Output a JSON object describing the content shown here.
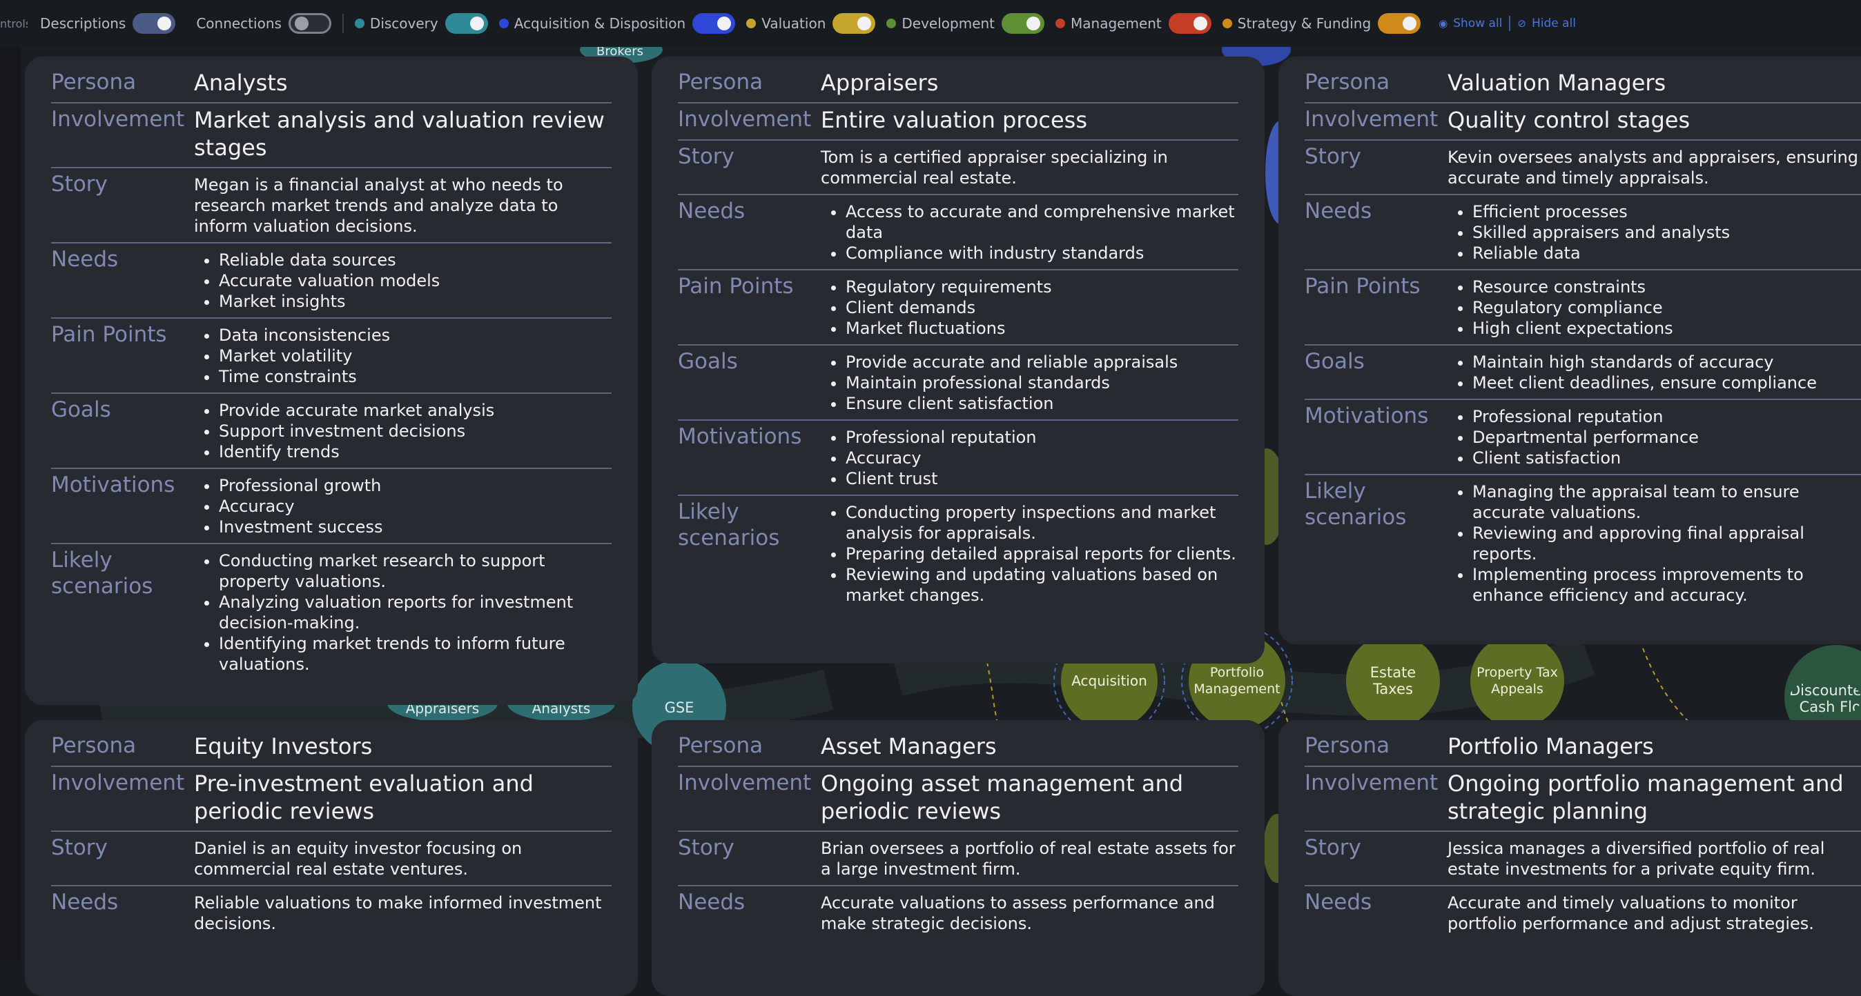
{
  "toolbar": {
    "controls_label": "ntrols",
    "descriptions_label": "Descriptions",
    "connections_label": "Connections",
    "categories": [
      {
        "label": "Discovery",
        "color": "#2d8a96"
      },
      {
        "label": "Acquisition & Disposition",
        "color": "#2f47d6"
      },
      {
        "label": "Valuation",
        "color": "#c6a52c"
      },
      {
        "label": "Development",
        "color": "#5f8f34"
      },
      {
        "label": "Management",
        "color": "#c43d25"
      },
      {
        "label": "Strategy & Funding",
        "color": "#d08a1c"
      }
    ],
    "show_all": "Show all",
    "hide_all": "Hide all"
  },
  "field_labels": {
    "persona": "Persona",
    "involvement": "Involvement",
    "story": "Story",
    "needs": "Needs",
    "pain_points": "Pain Points",
    "goals": "Goals",
    "motivations": "Motivations",
    "likely_scenarios": "Likely scenarios"
  },
  "background_labels": {
    "brokers": "Brokers",
    "appraisers": "Appraisers",
    "analysts": "Analysts",
    "gse": "GSE",
    "acquisition": "Acquisition",
    "portfolio_management": "Portfolio Management",
    "estate_taxes": "Estate Taxes",
    "property_tax_appeals": "Property Tax Appeals",
    "discounted_cash_flow": "Discounted Cash Flo"
  },
  "cards": [
    {
      "persona": "Analysts",
      "involvement": "Market analysis and valuation review stages",
      "story": "Megan is a financial analyst at who needs to research market trends and analyze data to inform valuation decisions.",
      "needs": [
        "Reliable data sources",
        "Accurate valuation models",
        "Market insights"
      ],
      "pain_points": [
        "Data inconsistencies",
        "Market volatility",
        "Time constraints"
      ],
      "goals": [
        "Provide accurate market analysis",
        "Support investment decisions",
        "Identify trends"
      ],
      "motivations": [
        "Professional growth",
        "Accuracy",
        "Investment success"
      ],
      "likely_scenarios": [
        "Conducting market research to support property valuations.",
        "Analyzing valuation reports for investment decision-making.",
        "Identifying market trends to inform future valuations."
      ]
    },
    {
      "persona": "Appraisers",
      "involvement": "Entire valuation process",
      "story": "Tom is a certified appraiser specializing in commercial real estate.",
      "needs": [
        "Access to accurate and comprehensive market data",
        "Compliance with industry standards"
      ],
      "pain_points": [
        "Regulatory requirements",
        "Client demands",
        "Market fluctuations"
      ],
      "goals": [
        "Provide accurate and reliable appraisals",
        "Maintain professional standards",
        "Ensure client satisfaction"
      ],
      "motivations": [
        "Professional reputation",
        "Accuracy",
        "Client trust"
      ],
      "likely_scenarios": [
        "Conducting property inspections and market analysis for appraisals.",
        "Preparing detailed appraisal reports for clients.",
        "Reviewing and updating valuations based on market changes."
      ]
    },
    {
      "persona": "Valuation Managers",
      "involvement": "Quality control stages",
      "story": "Kevin oversees analysts and appraisers, ensuring accurate and timely appraisals.",
      "needs": [
        "Efficient processes",
        "Skilled appraisers and analysts",
        "Reliable data"
      ],
      "pain_points": [
        "Resource constraints",
        "Regulatory compliance",
        "High client expectations"
      ],
      "goals": [
        "Maintain high standards of accuracy",
        "Meet client deadlines, ensure compliance"
      ],
      "motivations": [
        "Professional reputation",
        "Departmental performance",
        "Client satisfaction"
      ],
      "likely_scenarios": [
        "Managing the appraisal team to ensure accurate valuations.",
        "Reviewing and approving final appraisal reports.",
        "Implementing process improvements to enhance efficiency and accuracy."
      ]
    },
    {
      "persona": "Equity Investors",
      "involvement": "Pre-investment evaluation and periodic reviews",
      "story": "Daniel is an equity investor focusing on commercial real estate ventures.",
      "needs_text": "Reliable valuations to make informed investment decisions."
    },
    {
      "persona": "Asset Managers",
      "involvement": "Ongoing asset management and periodic reviews",
      "story": "Brian oversees a portfolio of real estate assets for a large investment firm.",
      "needs_text": "Accurate valuations to assess performance and make strategic decisions."
    },
    {
      "persona": "Portfolio Managers",
      "involvement": "Ongoing portfolio management and strategic planning",
      "story": "Jessica manages a diversified portfolio of real estate investments for a private equity firm.",
      "needs_text": "Accurate and timely valuations to monitor portfolio performance and adjust strategies."
    }
  ]
}
